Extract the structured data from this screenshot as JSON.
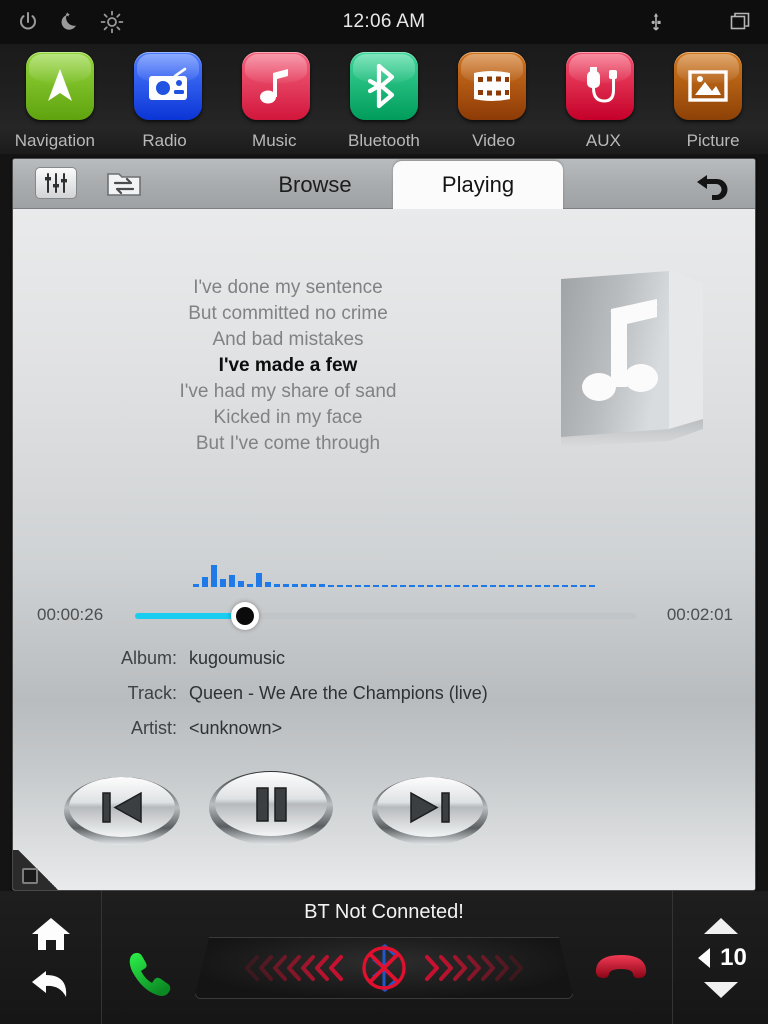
{
  "statusbar": {
    "time": "12:06 AM",
    "icons": [
      "power-icon",
      "night-mode-icon",
      "brightness-icon",
      "usb-icon",
      "windows-icon"
    ]
  },
  "dock": {
    "apps": [
      {
        "label": "Navigation",
        "icon": "navigation-arrow-icon",
        "color": "#7ec21f"
      },
      {
        "label": "Radio",
        "icon": "radio-icon",
        "color": "#1f53e0"
      },
      {
        "label": "Music",
        "icon": "music-note-icon",
        "color": "#e8415c"
      },
      {
        "label": "Bluetooth",
        "icon": "bluetooth-icon",
        "color": "#15b870"
      },
      {
        "label": "Video",
        "icon": "film-strip-icon",
        "color": "#b3500f"
      },
      {
        "label": "AUX",
        "icon": "aux-cable-icon",
        "color": "#e5153f"
      },
      {
        "label": "Picture",
        "icon": "picture-icon",
        "color": "#b3560f"
      }
    ]
  },
  "player": {
    "toolbar": {
      "equalizer_icon": "equalizer-icon",
      "folder_icon": "folder-swap-icon",
      "browse_tab": "Browse",
      "playing_tab": "Playing",
      "back_icon": "undo-arrow-icon"
    },
    "lyrics": [
      {
        "text": "I've done my sentence",
        "active": false
      },
      {
        "text": "But committed no crime",
        "active": false
      },
      {
        "text": "And bad mistakes",
        "active": false
      },
      {
        "text": "I've made a few",
        "active": true
      },
      {
        "text": "I've had my share of sand",
        "active": false
      },
      {
        "text": "Kicked in my face",
        "active": false
      },
      {
        "text": "But I've come through",
        "active": false
      }
    ],
    "album_art_icon": "music-note-placeholder-icon",
    "progress": {
      "elapsed": "00:00:26",
      "total": "00:02:01",
      "percent": 22,
      "fill_color": "#18cdf0"
    },
    "spectrum": {
      "color": "#1f7ae8",
      "bars": [
        3,
        10,
        22,
        8,
        12,
        6,
        3,
        14,
        5,
        3,
        3,
        3,
        3,
        3,
        3,
        2,
        2,
        2,
        2,
        2,
        2,
        2,
        2,
        2,
        2,
        2,
        2,
        2,
        2,
        2,
        2,
        2,
        2,
        2,
        2,
        2,
        2,
        2,
        2,
        2,
        2,
        2,
        2,
        2,
        2
      ]
    },
    "metadata": [
      {
        "label": "Album:",
        "value": "kugoumusic"
      },
      {
        "label": "Track:",
        "value": "Queen - We Are the Champions (live)"
      },
      {
        "label": "Artist:",
        "value": "<unknown>"
      }
    ],
    "transport": [
      {
        "name": "previous-button",
        "icon": "skip-previous-icon"
      },
      {
        "name": "pause-button",
        "icon": "pause-icon"
      },
      {
        "name": "next-button",
        "icon": "skip-next-icon"
      }
    ]
  },
  "bottombar": {
    "home_icon": "home-icon",
    "back_icon": "back-arrow-icon",
    "answer_icon": "phone-answer-icon",
    "hangup_icon": "phone-hangup-icon",
    "bt_status": "BT Not Conneted!",
    "bt_indicator_icon": "bluetooth-disabled-icon",
    "volume": {
      "up_icon": "volume-up-icon",
      "down_icon": "volume-down-icon",
      "speaker_icon": "speaker-icon",
      "level": "10"
    }
  }
}
